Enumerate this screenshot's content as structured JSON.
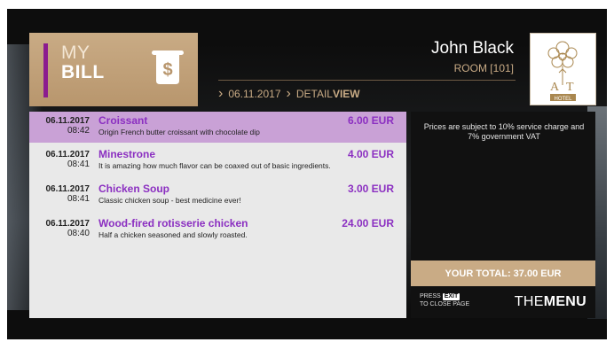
{
  "header": {
    "title_line1": "MY",
    "title_line2": "BILL",
    "bill_icon": "receipt-dollar-icon",
    "breadcrumb": {
      "date": "06.11.2017",
      "section_prefix": "DETAIL",
      "section_bold": "VIEW"
    },
    "guest": {
      "name": "John Black",
      "room": "ROOM [101]"
    },
    "logo_text": "A T HOTEL"
  },
  "bill_items": [
    {
      "date": "06.11.2017",
      "time": "08:42",
      "name": "Croissant",
      "description": "Origin French butter croissant with chocolate dip",
      "price": "6.00 EUR",
      "selected": true
    },
    {
      "date": "06.11.2017",
      "time": "08:41",
      "name": "Minestrone",
      "description": "It is amazing how much flavor can be coaxed out of basic ingredients.",
      "price": "4.00 EUR",
      "selected": false
    },
    {
      "date": "06.11.2017",
      "time": "08:41",
      "name": "Chicken Soup",
      "description": "Classic chicken soup - best medicine ever!",
      "price": "3.00 EUR",
      "selected": false
    },
    {
      "date": "06.11.2017",
      "time": "08:40",
      "name": "Wood-fired rotisserie chicken",
      "description": "Half a chicken seasoned and slowly roasted.",
      "price": "24.00 EUR",
      "selected": false
    }
  ],
  "side_panel": {
    "notice": "Prices are subject to 10% service charge and 7% government VAT",
    "total": "YOUR TOTAL: 37.00 EUR",
    "exit_press": "PRESS",
    "exit_key": "EXIT",
    "exit_action": "TO CLOSE PAGE",
    "brand_light": "THE",
    "brand_bold": "MENU"
  },
  "colors": {
    "accent_gold": "#c9ab85",
    "accent_purple": "#8b2fc1",
    "selected_row": "#c9a1d6"
  }
}
